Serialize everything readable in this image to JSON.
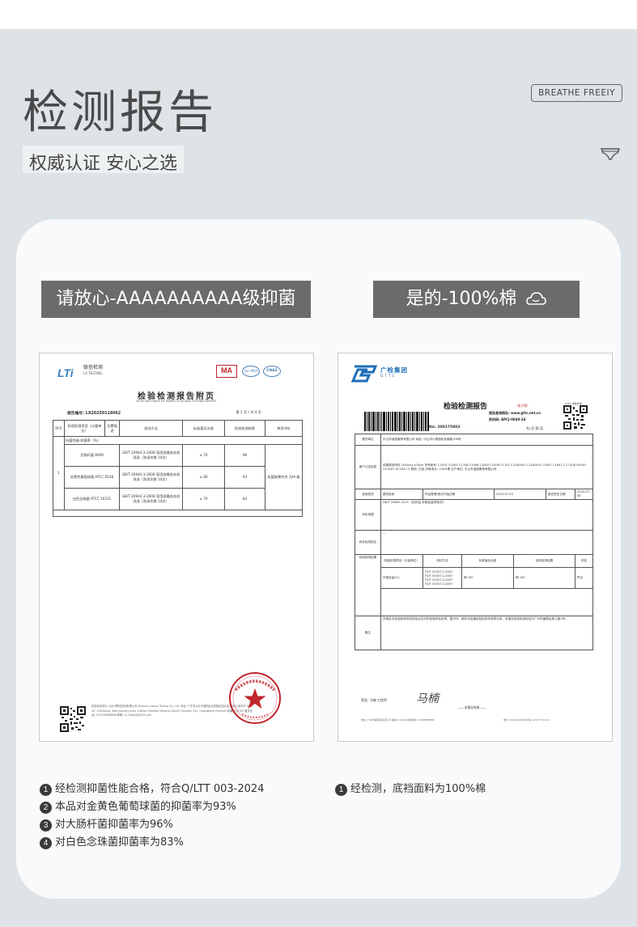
{
  "header": {
    "title": "检测报告",
    "subtitle": "权威认证 安心之选",
    "brand_tag": "BREATHE FREEIY",
    "brand_icon": "underwear-icon"
  },
  "banners": {
    "left": "请放心-AAAAAAAAAA级抑菌",
    "right": "是的-100%棉",
    "right_icon": "cloud-icon"
  },
  "left_report": {
    "logo_mark": "LTi",
    "logo_name": "联信检测",
    "logo_sub": "LX TESTING",
    "cert_ma": "MA",
    "cert_ilac": "ilac-MRA",
    "cert_cnas": "CNAS",
    "title": "检验检测报告附页",
    "subtitle": "ATTACHED PAGE OF INSPECTION AND TESTING REPORT",
    "report_no": "报告编号: LX20250118062",
    "page": "第 2 页 / 共 4 页",
    "headers": [
      "序号",
      "检验检测项目（计量单位）",
      "位置描述",
      "测试方法",
      "标准值及允差",
      "检验检测结果",
      "单项评价"
    ],
    "section": "抗菌性能-抑菌率（%）",
    "row_index": "1",
    "rows": [
      {
        "item": "大肠杆菌 8099",
        "method": "GB/T 20944.3-2008 家用双桶洗衣机洗涤（洗涤次数 10次）",
        "standard": "≥ 70",
        "result": "96"
      },
      {
        "item": "金黄色葡萄球菌 ATCC 6538",
        "method": "GB/T 20944.3-2008 家用双桶洗衣机洗涤（洗涤次数 10次）",
        "standard": "≥ 80",
        "result": "93"
      },
      {
        "item": "白色念珠菌 ATCC 10231",
        "method": "GB/T 20944.3-2008 家用双桶洗衣机洗涤（洗涤次数 10次）",
        "standard": "≥ 70",
        "result": "83"
      }
    ],
    "evaluation": "抗菌效果符合 10A 级",
    "address": "检验检测单位: 汕头市联信检测有限公司 Shantou Lianxin Testing Co., Ltd. 地址: 广东省汕头市潮阳区谷饶镇谷饶北溪工业区4栋东厅 Add: 4/F, A Building, Xiba Industry Area, Xiaotou Shantou Deyang District, Shantou City, Guangdong Province 邮编: 515100 服务电话: 0754-88888888 邮箱: LX_Testing@163.com",
    "seal_text": "检验检测专用章"
  },
  "right_report": {
    "logo_name": "广检集团",
    "logo_en": "GTTC",
    "title": "检验检测报告",
    "edition": "（电子版）",
    "tag": "GTTC 报告查询",
    "query_site": "报告查询网址: www.gttc.net.cn",
    "anti_fake": "防伪码: APCJ-0849-34",
    "pages": "共1页 第1页",
    "report_no": "No: 200175803",
    "client_label": "委托单位",
    "client": "中山市诚旭服饰有限公司 地址: 中山市小榄镇民安南路106号",
    "sample_label": "客户认定信息",
    "sample": "纯棉底档布料 100cm×100cm 货号款号: C1001 C1005 C1706 C1008 C1002 C1006 C1701 C1180001 C1181001 C1647 C1647-2 C1108 HC901 HC1647 HC1647-2 颜色: 白色 纤维成分: 100%棉 生产单位: 中山市诚旭服饰有限公司",
    "nature_label": "检验性质",
    "nature": "委托检测",
    "received_label": "样品受理/测试开始日期",
    "received": "2020-07-03",
    "issue_label": "报告签发日期",
    "issue": "2020-07-08",
    "basis_label": "判定依据",
    "basis": "GB/T 29862-2013 《纺织品 纤维含量的标识》",
    "conclusion_label": "综合检测结论",
    "conclusion": "—",
    "results_label": "检验检测结果",
    "results_headers": [
      "检验检测项目（计量单位）",
      "测试方法",
      "标准值及允差",
      "检验检测结果",
      "判定"
    ],
    "results_item": "纤维含量(%)",
    "results_method": "FZ/T 01057.1-2007 FZ/T 01057.2-2007 FZ/T 01057.3-2007 FZ/T 01057.4-2007",
    "results_standard": "棉 100",
    "results_value": "棉 100",
    "results_verdict": "符合",
    "remarks_label": "备注",
    "remarks": "本报告中检验检测项目的结论仅对所检验样品负责。复印件、副本未加盖检验检测专用章无效。本报告检验检测地址为广州市番禺区珠江路1号。",
    "signer": "签发: 马楠 工程师",
    "signature": "马楠",
    "end": "——本报告结束——",
    "foot_left": "地址: 广州市番禺区珠江路1号 邮编: 511400 客服热线: 020-88888888",
    "foot_right": "电话: 020-61999999 传真: 020-57721111"
  },
  "notes_left": [
    {
      "num": "1",
      "text": "经检测抑菌性能合格，符合Q/LTT 003-2024"
    },
    {
      "num": "2",
      "text": "本品对金黄色葡萄球菌的抑菌率为93%"
    },
    {
      "num": "3",
      "text": "对大肠杆菌抑菌率为96%"
    },
    {
      "num": "4",
      "text": "对白色念珠菌抑菌率为83%"
    }
  ],
  "notes_right": [
    {
      "num": "1",
      "text": "经检测，底裆面料为100%棉"
    }
  ],
  "colors": {
    "background": "#dde3e6",
    "card": "#fafafa",
    "banner": "#6b6b6b",
    "seal": "#c0262d",
    "gttc_blue": "#1d6fb8"
  }
}
